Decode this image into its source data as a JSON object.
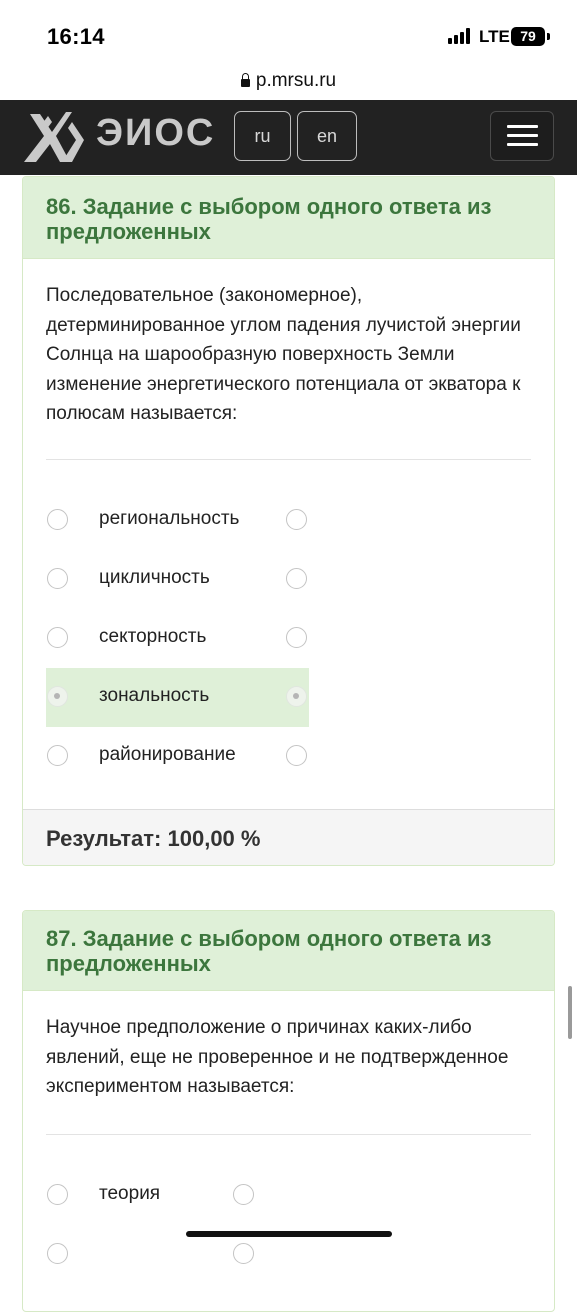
{
  "status_bar": {
    "time": "16:14",
    "network": "LTE",
    "battery": "79"
  },
  "browser": {
    "url": "p.mrsu.ru"
  },
  "header": {
    "logo_text": "ЭИОС",
    "lang_ru": "ru",
    "lang_en": "en",
    "background": "#222222"
  },
  "questions": [
    {
      "title": "86. Задание с выбором одного ответа из предложенных",
      "text": "Последовательное (закономерное), детерминированное углом падения лучистой энергии Солнца на шарообразную поверхность Земли изменение энергетического потенциала от экватора к полюсам называется:",
      "options": [
        {
          "label": "региональность",
          "selected": false
        },
        {
          "label": "цикличность",
          "selected": false
        },
        {
          "label": "секторность",
          "selected": false
        },
        {
          "label": "зональность",
          "selected": true
        },
        {
          "label": "районирование",
          "selected": false
        }
      ],
      "result_label": "Результат:",
      "result_value": "100,00 %"
    },
    {
      "title": "87. Задание с выбором одного ответа из предложенных",
      "text": "Научное предположение о причинах каких-либо явлений, еще не проверенное и не подтвержденное экспериментом называется:",
      "options": [
        {
          "label": "теория",
          "selected": false
        }
      ]
    }
  ],
  "colors": {
    "panel_header_bg": "#dff0d8",
    "panel_header_text": "#3c763d",
    "panel_border": "#d6e9c6"
  },
  "icons": {
    "logo": "mrsu-logo-icon",
    "lock": "lock-icon",
    "menu": "hamburger-icon"
  }
}
